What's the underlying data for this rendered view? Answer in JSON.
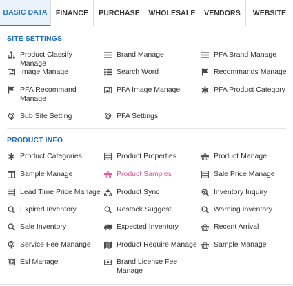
{
  "tabs": [
    {
      "label": "BASIC DATA",
      "active": true
    },
    {
      "label": "FINANCE",
      "active": false
    },
    {
      "label": "PURCHASE",
      "active": false
    },
    {
      "label": "WHOLESALE",
      "active": false
    },
    {
      "label": "VENDORS",
      "active": false
    },
    {
      "label": "WEBSITE",
      "active": false
    }
  ],
  "site_settings": {
    "title": "SITE SETTINGS",
    "items": [
      {
        "label": "Product Classify Manage",
        "icon": "sitemap-icon"
      },
      {
        "label": "Brand Manage",
        "icon": "list-icon"
      },
      {
        "label": "PFA Brand Manage",
        "icon": "list-icon"
      },
      {
        "label": "Image Manage",
        "icon": "image-icon"
      },
      {
        "label": "Search Word",
        "icon": "list-alt-icon"
      },
      {
        "label": "Recommands Manage",
        "icon": "flag-icon"
      },
      {
        "label": "PFA Recommand Manage",
        "icon": "flag-icon"
      },
      {
        "label": "PFA Image Manage",
        "icon": "image-icon"
      },
      {
        "label": "PFA Product Category",
        "icon": "asterisk-icon"
      },
      {
        "label": "Sub Site Setting",
        "icon": "podcast-icon"
      },
      {
        "label": "PFA Settings",
        "icon": "podcast-icon"
      }
    ]
  },
  "product_info": {
    "title": "PRODUCT INFO",
    "items": [
      {
        "label": "Product Categories",
        "icon": "asterisk-icon"
      },
      {
        "label": "Product Properties",
        "icon": "server-icon"
      },
      {
        "label": "Product Manage",
        "icon": "basket-icon"
      },
      {
        "label": "Sample Manage",
        "icon": "columns-icon"
      },
      {
        "label": "Product Samples",
        "icon": "basket-icon",
        "highlight": "#d9569a"
      },
      {
        "label": "Sale Price Manage",
        "icon": "server-icon"
      },
      {
        "label": "Lead Time Price Manage",
        "icon": "server-icon"
      },
      {
        "label": "Product Sync",
        "icon": "recycle-icon"
      },
      {
        "label": "Inventory Inquiry",
        "icon": "zoom-in-icon"
      },
      {
        "label": "Expired Inventory",
        "icon": "zoom-in-icon"
      },
      {
        "label": "Restock Suggest",
        "icon": "search-icon"
      },
      {
        "label": "Warning Inventory",
        "icon": "search-icon"
      },
      {
        "label": "Sale Inventory",
        "icon": "search-icon"
      },
      {
        "label": "Expected Inventory",
        "icon": "truck-icon"
      },
      {
        "label": "Recent Arrival",
        "icon": "basket-icon"
      },
      {
        "label": "Service Fee Manange",
        "icon": "podcast-icon"
      },
      {
        "label": "Product Require Manage",
        "icon": "map-icon"
      },
      {
        "label": "Sample Manage",
        "icon": "basket-icon"
      },
      {
        "label": "Esl Manage",
        "icon": "id-card-icon"
      },
      {
        "label": "Brand License Fee Manage",
        "icon": "money-icon"
      }
    ]
  },
  "colors": {
    "accent": "#1f6fc1",
    "active_tab_bg": "#eaf2fb",
    "highlight": "#d9569a"
  }
}
